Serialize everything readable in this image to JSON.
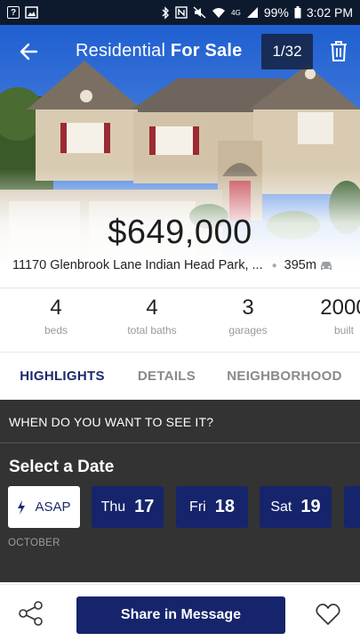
{
  "status_bar": {
    "left_icons": [
      "help-box-icon",
      "image-icon"
    ],
    "right_icons": [
      "bluetooth-icon",
      "nfc-icon",
      "mute-icon",
      "wifi-icon",
      "signal-4g-icon",
      "signal-icon"
    ],
    "network": "4G",
    "battery": "99%",
    "time": "3:02 PM"
  },
  "header": {
    "title_prefix": "Residential",
    "title_bold": "For Sale",
    "photo_counter": "1/32",
    "back_icon": "arrow-left-icon",
    "delete_icon": "trash-icon"
  },
  "listing": {
    "price": "$649,000",
    "address": "11170 Glenbrook Lane Indian Head Park, ...",
    "distance": "395m",
    "distance_icon": "car-icon"
  },
  "stats": [
    {
      "value": "4",
      "label": "beds"
    },
    {
      "value": "4",
      "label": "total baths"
    },
    {
      "value": "3",
      "label": "garages"
    },
    {
      "value": "2000",
      "label": "built"
    }
  ],
  "tabs": [
    {
      "label": "HIGHLIGHTS",
      "active": true
    },
    {
      "label": "DETAILS",
      "active": false
    },
    {
      "label": "NEIGHBORHOOD",
      "active": false
    }
  ],
  "schedule": {
    "question": "WHEN DO YOU WANT TO SEE IT?",
    "select_title": "Select a Date",
    "asap_label": "ASAP",
    "asap_icon": "lightning-icon",
    "dates": [
      {
        "day": "Thu",
        "num": "17"
      },
      {
        "day": "Fri",
        "num": "18"
      },
      {
        "day": "Sat",
        "num": "19"
      }
    ],
    "month": "OCTOBER"
  },
  "bottom": {
    "share_icon": "share-icon",
    "share_message_label": "Share in Message",
    "favorite_icon": "heart-icon"
  },
  "colors": {
    "brand_navy": "#16246b",
    "panel_dark": "#333333",
    "status_bar": "#0d1a2e"
  }
}
